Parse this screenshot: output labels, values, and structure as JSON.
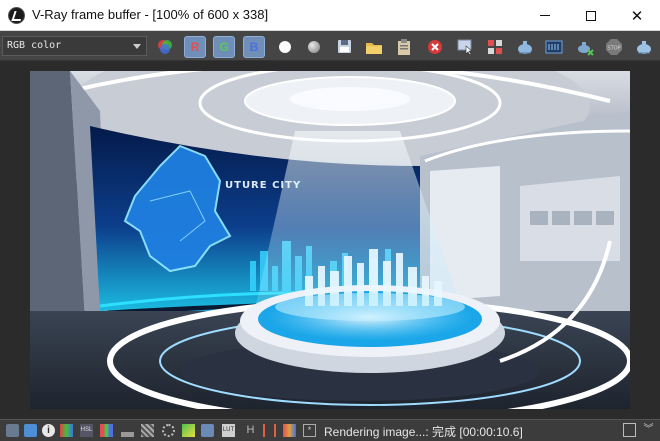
{
  "window": {
    "title": "V-Ray frame buffer - [100% of 600 x 338]",
    "controls": {
      "minimize": "—",
      "maximize": "☐",
      "close": "✕"
    }
  },
  "toolbar": {
    "channel_value": "RGB color",
    "rgb_buttons": [
      "R",
      "G",
      "B"
    ],
    "icons": [
      "color-corrections-icon",
      "red-channel-icon",
      "green-channel-icon",
      "blue-channel-icon",
      "mono-mode-icon",
      "alpha-mode-icon",
      "save-image-icon",
      "load-image-icon",
      "copy-to-clipboard-icon",
      "clear-image-icon",
      "follow-mouse-icon",
      "region-render-icon",
      "render-last-icon",
      "show-corrections-icon",
      "lens-effects-icon",
      "stop-render-icon",
      "render-icon"
    ]
  },
  "render": {
    "scene_text": "UTURE CITY"
  },
  "statusbar": {
    "status_text": "Rendering image...: 完成 [00:00:10.6]",
    "h_label": "H",
    "icons": [
      "history-icon",
      "info-icon",
      "color-levels-icon",
      "hsl-icon",
      "histogram-icon",
      "lut-icon",
      "exposure-icon",
      "white-balance-icon",
      "curve-icon",
      "lut-file-icon",
      "background-icon",
      "stereo-icon",
      "test-resolution-icon",
      "pixel-info-icon"
    ]
  },
  "colors": {
    "titlebar_bg": "#ffffff",
    "toolbar_bg": "#454545",
    "frame_bg": "#2b2b2b",
    "accent_blue": "#6f8fb8"
  }
}
